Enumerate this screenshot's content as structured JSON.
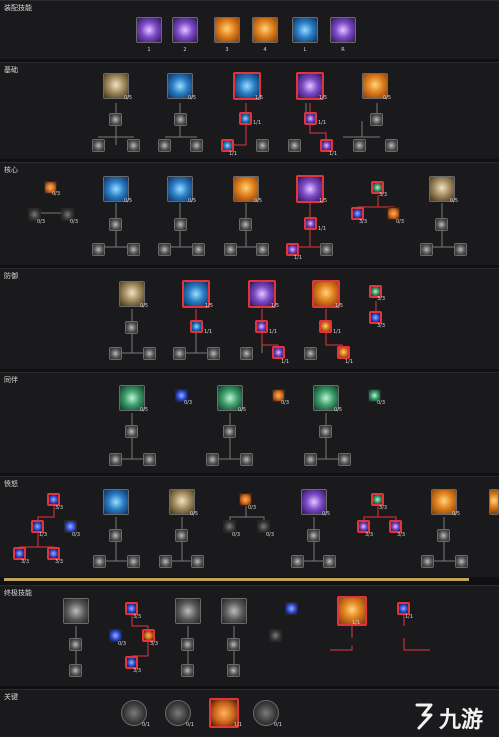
{
  "sections": {
    "equipped": "装配技能",
    "basic": "基础",
    "core": "核心",
    "defense": "防御",
    "companion": "同伴",
    "wrath": "愤怒",
    "ultimate": "终极技能",
    "key_passive": "关键"
  },
  "equip_slots": [
    "1",
    "2",
    "3",
    "4",
    "L",
    "R"
  ],
  "ranks": {
    "zero5": "0/5",
    "one5": "1/5",
    "one1": "1/1",
    "zero1": "0/1",
    "zero3": "0/3",
    "three3": "3/3",
    "one3": "1/3"
  },
  "watermark": {
    "text": "九游"
  },
  "colors": {
    "selected_border": "#e3343c",
    "divider": "#c2a35a",
    "background": "#101012"
  }
}
